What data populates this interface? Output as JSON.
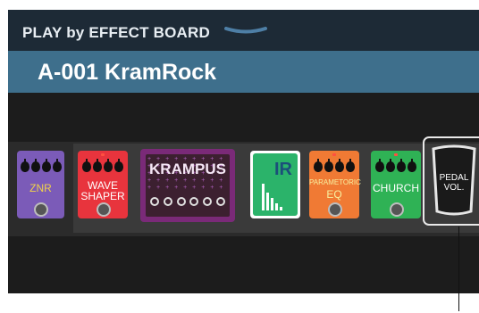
{
  "header": {
    "title": "PLAY by EFFECT BOARD"
  },
  "patch": {
    "name": "A-001 KramRock"
  },
  "pedals": [
    {
      "label": "ZNR",
      "color": "#7b5bb8"
    },
    {
      "label_line1": "WAVE",
      "label_line2": "SHAPER",
      "color": "#e8343d"
    },
    {
      "label": "KRAMPUS",
      "color": "#7a2a78"
    },
    {
      "label": "IR",
      "color": "#2bb36a"
    },
    {
      "label_line1": "PARAMETORIC",
      "label_line2": "EQ",
      "color": "#f07a34"
    },
    {
      "label": "CHURCH",
      "color": "#2fb255"
    },
    {
      "label_line1": "PEDAL",
      "label_line2": "VOL.",
      "color": "#1a1a1a"
    }
  ]
}
